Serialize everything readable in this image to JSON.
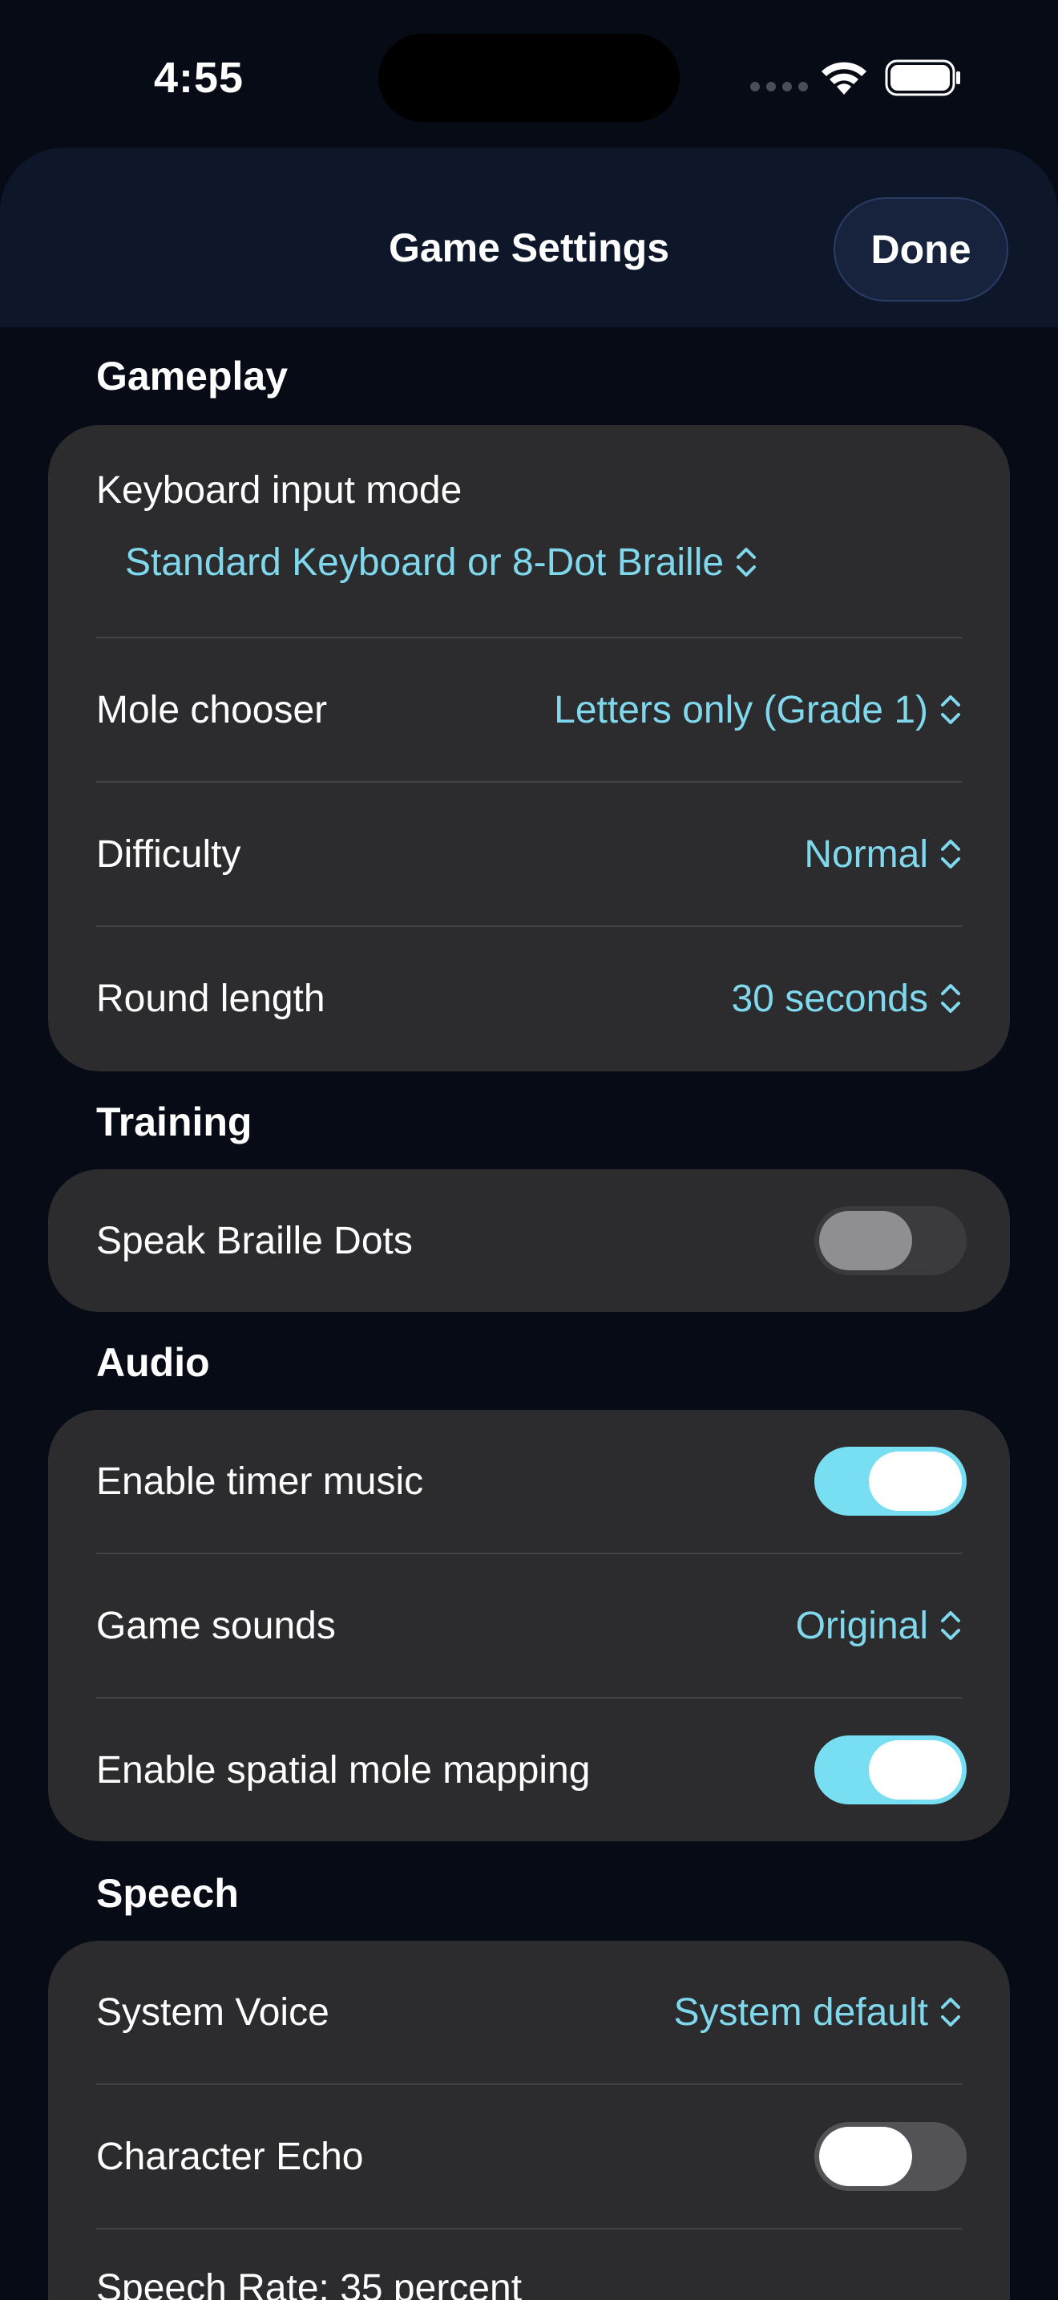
{
  "status": {
    "time": "4:55"
  },
  "nav": {
    "title": "Game Settings",
    "done_label": "Done"
  },
  "sections": {
    "gameplay": {
      "header": "Gameplay",
      "keyboard_mode": {
        "label": "Keyboard input mode",
        "value": "Standard Keyboard or 8-Dot Braille"
      },
      "mole_chooser": {
        "label": "Mole chooser",
        "value": "Letters only (Grade 1)"
      },
      "difficulty": {
        "label": "Difficulty",
        "value": "Normal"
      },
      "round_length": {
        "label": "Round length",
        "value": "30 seconds"
      }
    },
    "training": {
      "header": "Training",
      "speak_braille_dots": {
        "label": "Speak Braille Dots",
        "on": false,
        "enabled": false
      }
    },
    "audio": {
      "header": "Audio",
      "timer_music": {
        "label": "Enable timer music",
        "on": true
      },
      "game_sounds": {
        "label": "Game sounds",
        "value": "Original"
      },
      "spatial_mapping": {
        "label": "Enable spatial mole mapping",
        "on": true
      }
    },
    "speech": {
      "header": "Speech",
      "system_voice": {
        "label": "System Voice",
        "value": "System default"
      },
      "character_echo": {
        "label": "Character Echo",
        "on": false
      },
      "speech_rate": {
        "label": "Speech Rate: 35 percent"
      }
    }
  },
  "colors": {
    "accent": "#7fd8ec",
    "toggle_on": "#78def2",
    "card": "#2c2c2e",
    "background": "#070b15",
    "nav": "#0d1729"
  }
}
